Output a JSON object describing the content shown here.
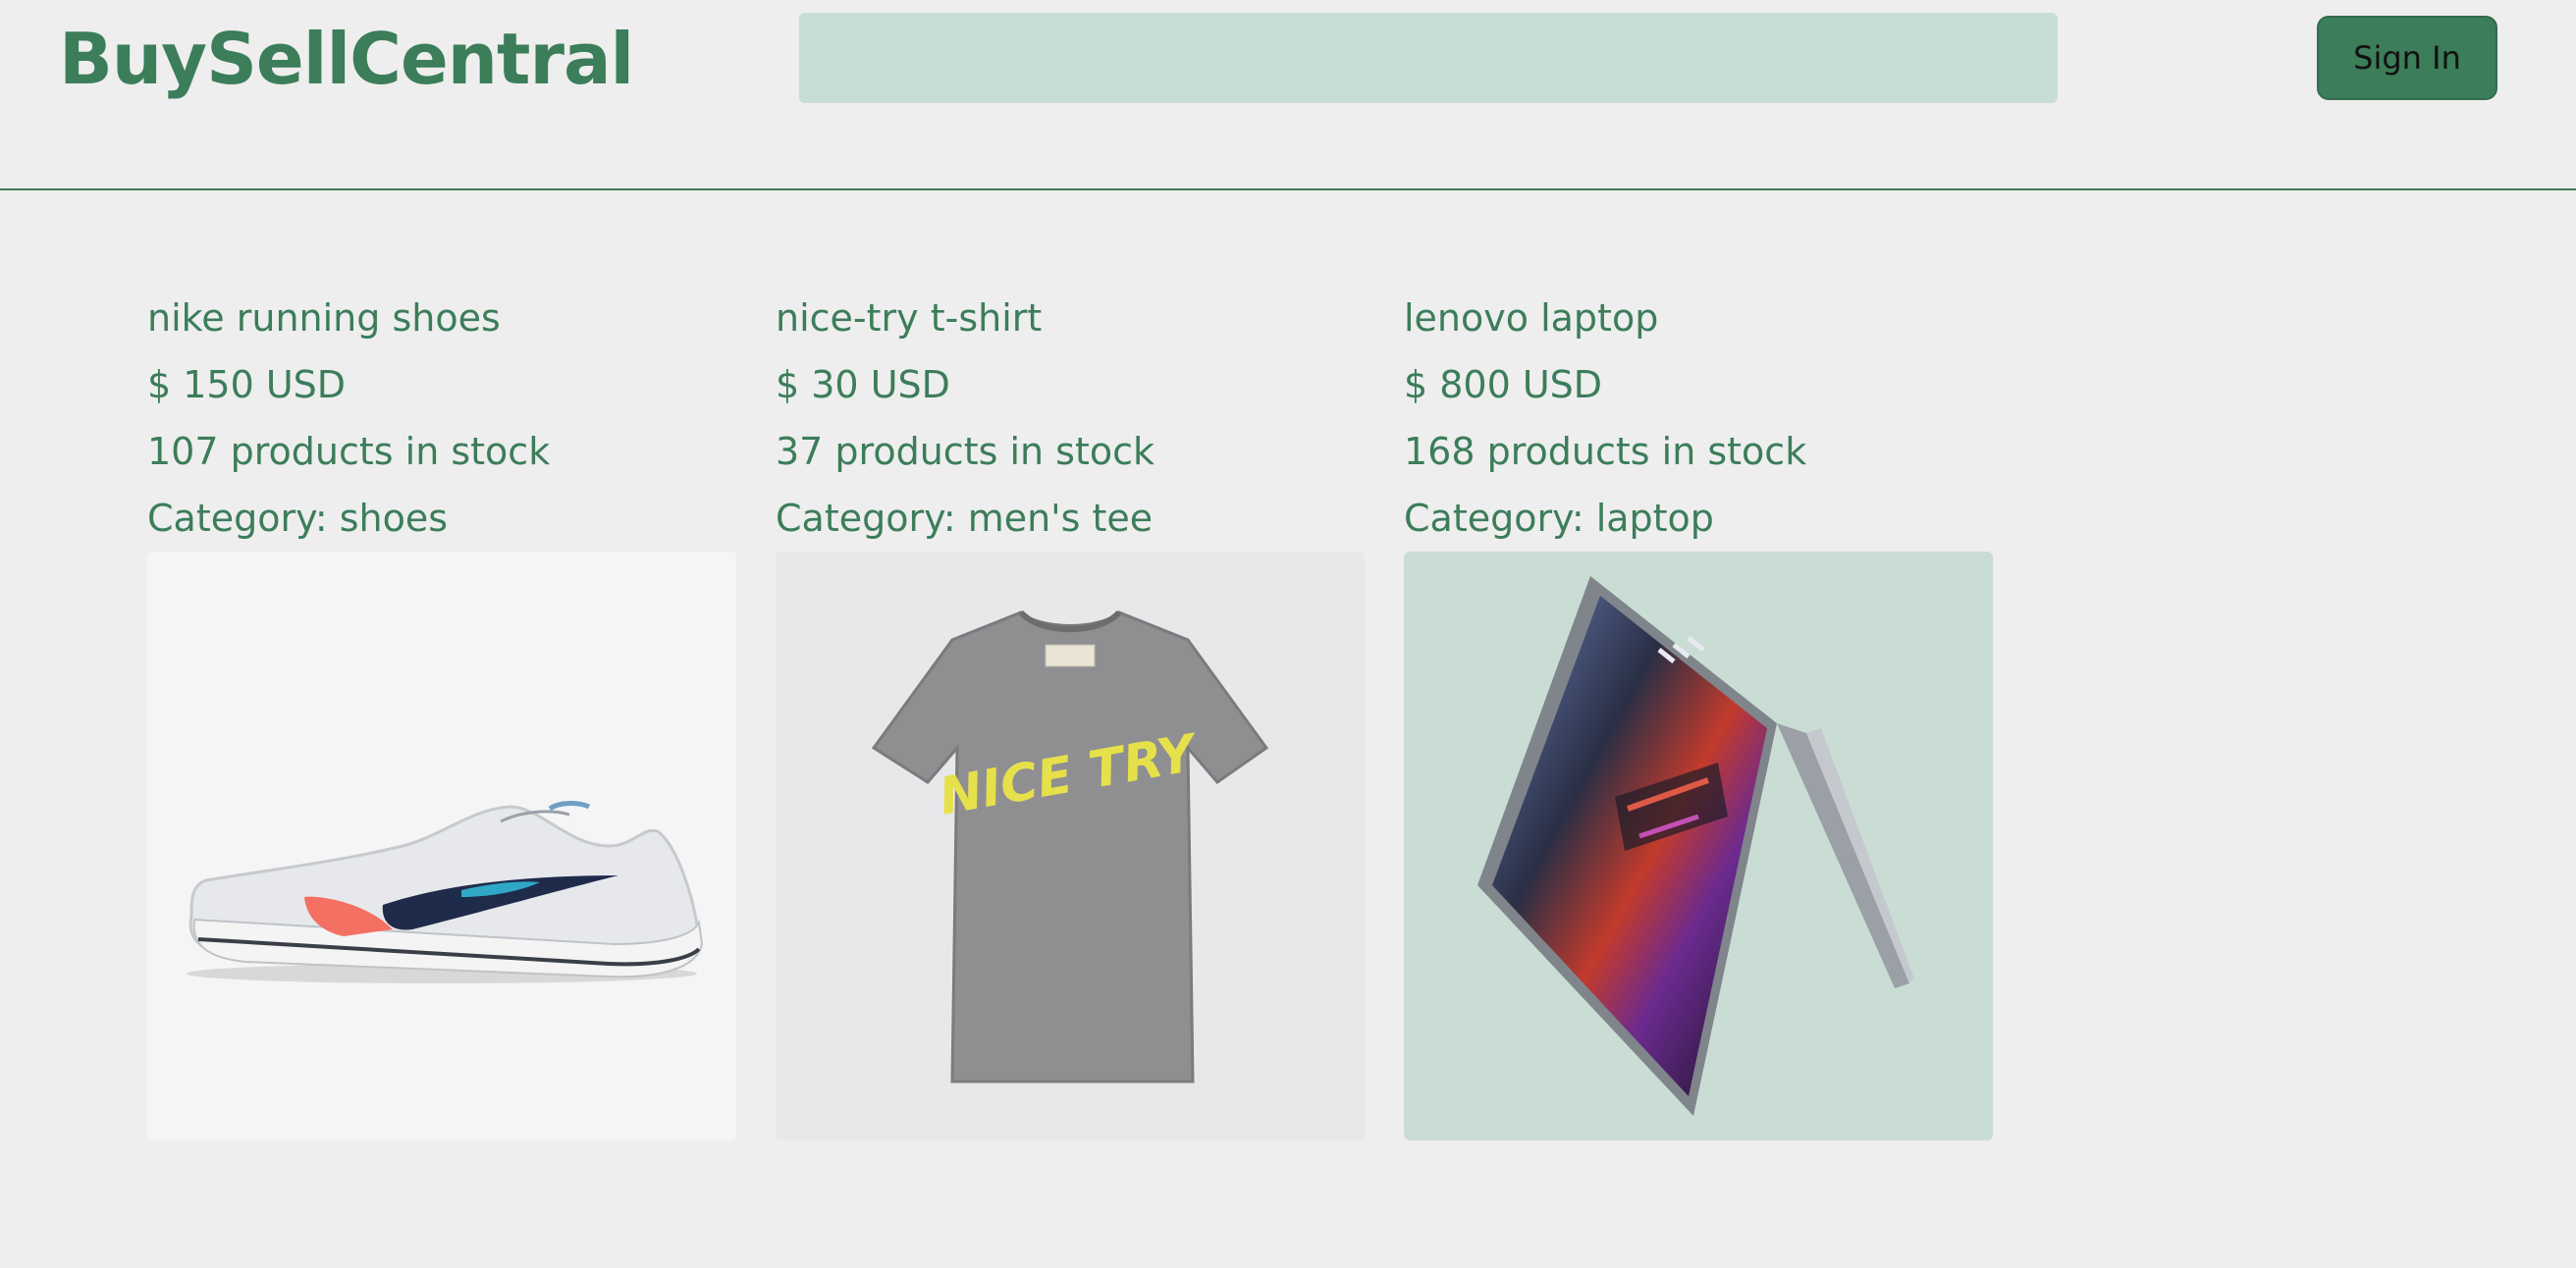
{
  "header": {
    "logo": "BuySellCentral",
    "search_placeholder": "",
    "sign_in_label": "Sign In"
  },
  "products": [
    {
      "name": "nike running shoes",
      "price": "$ 150 USD",
      "stock": "107 products in stock",
      "category": "Category: shoes",
      "image_icon": "running-shoe"
    },
    {
      "name": "nice-try t-shirt",
      "price": "$ 30 USD",
      "stock": "37 products in stock",
      "category": "Category: men's tee",
      "image_icon": "t-shirt",
      "image_text": "NICE TRY"
    },
    {
      "name": "lenovo laptop",
      "price": "$ 800 USD",
      "stock": "168 products in stock",
      "category": "Category: laptop",
      "image_icon": "laptop"
    }
  ],
  "colors": {
    "brand": "#3c7d5a",
    "search_bg": "#c8ddd4",
    "page_bg": "#eeeeee"
  }
}
